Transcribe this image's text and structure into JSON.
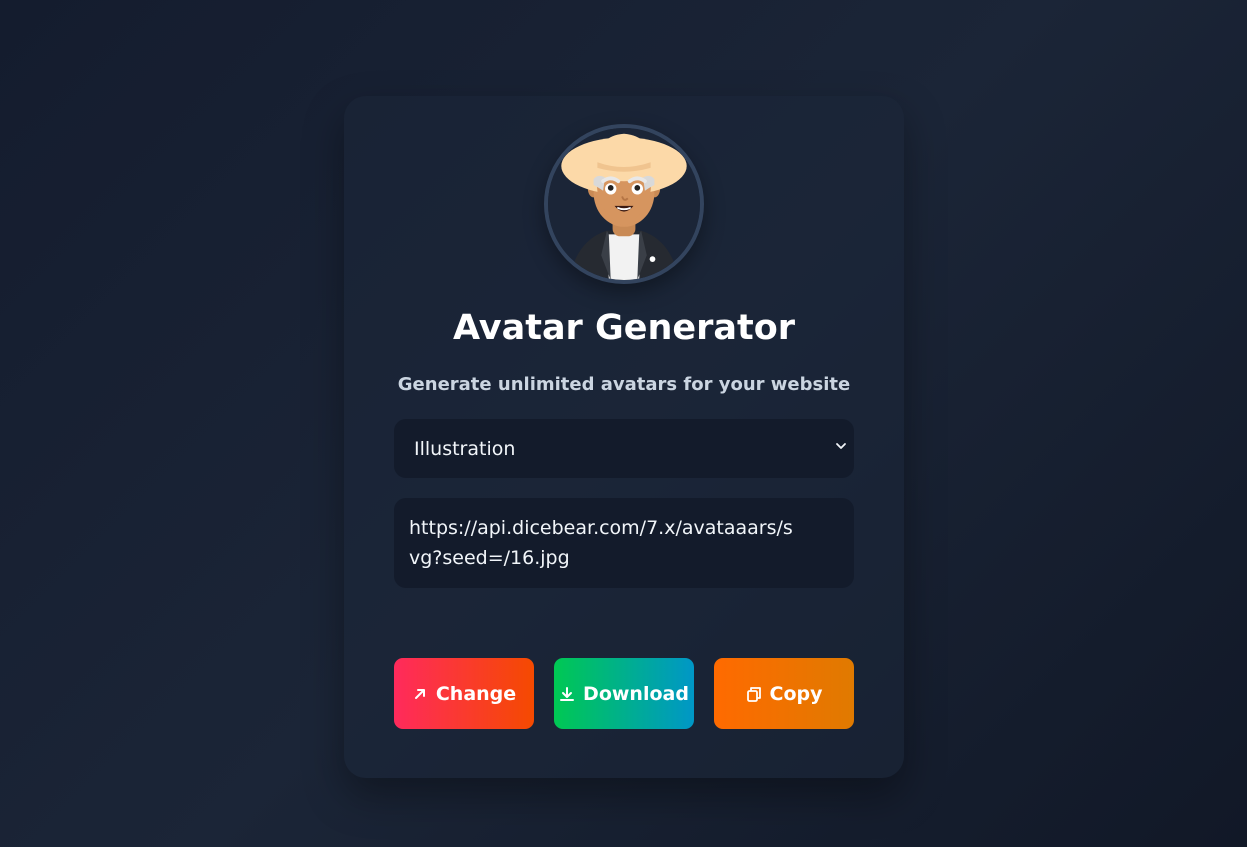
{
  "app": {
    "title": "Avatar Generator",
    "subtitle": "Generate unlimited avatars for your website"
  },
  "style_select": {
    "selected": "Illustration",
    "icon": "chevron-down-icon"
  },
  "url_field": {
    "value": "https://api.dicebear.com/7.x/avataaars/svg?seed=/16.jpg"
  },
  "buttons": {
    "change": {
      "label": "Change",
      "icon": "arrow-up-right-icon"
    },
    "download": {
      "label": "Download",
      "icon": "download-icon"
    },
    "copy": {
      "label": "Copy",
      "icon": "copy-icon"
    }
  },
  "colors": {
    "background": "#1b2537",
    "field": "#131b2b",
    "change_gradient": [
      "#ff2a5c",
      "#f54a00"
    ],
    "download_gradient": [
      "#00c853",
      "#0097c7"
    ],
    "copy_gradient": [
      "#ff6a00",
      "#e07a00"
    ]
  }
}
